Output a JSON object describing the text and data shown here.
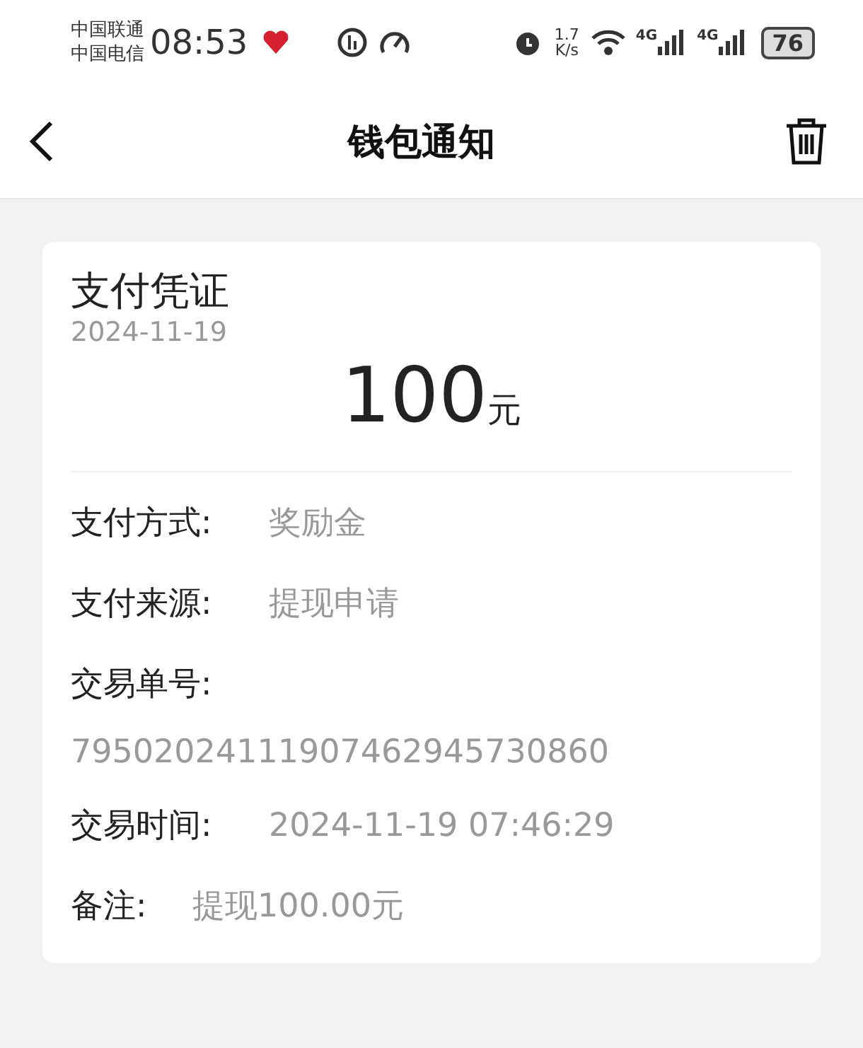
{
  "status_bar": {
    "carriers": [
      "中国联通",
      "中国电信"
    ],
    "time": "08:53",
    "net_speed": [
      "1.7",
      "K/s"
    ],
    "signals": [
      {
        "label": "4G"
      },
      {
        "label": "4G"
      }
    ],
    "battery": "76"
  },
  "header": {
    "title": "钱包通知"
  },
  "voucher": {
    "title": "支付凭证",
    "date": "2024-11-19",
    "amount": "100",
    "unit": "元",
    "fields": [
      {
        "kind": "inline",
        "label": "支付方式:",
        "value": "奖励金"
      },
      {
        "kind": "inline",
        "label": "支付来源:",
        "value": "提现申请"
      },
      {
        "kind": "stacked",
        "label": "交易单号:",
        "value": "79502024111907462945730860"
      },
      {
        "kind": "inline",
        "label": "交易时间:",
        "value": "2024-11-19 07:46:29"
      },
      {
        "kind": "compact",
        "label": "备注:",
        "value": "提现100.00元"
      }
    ]
  }
}
